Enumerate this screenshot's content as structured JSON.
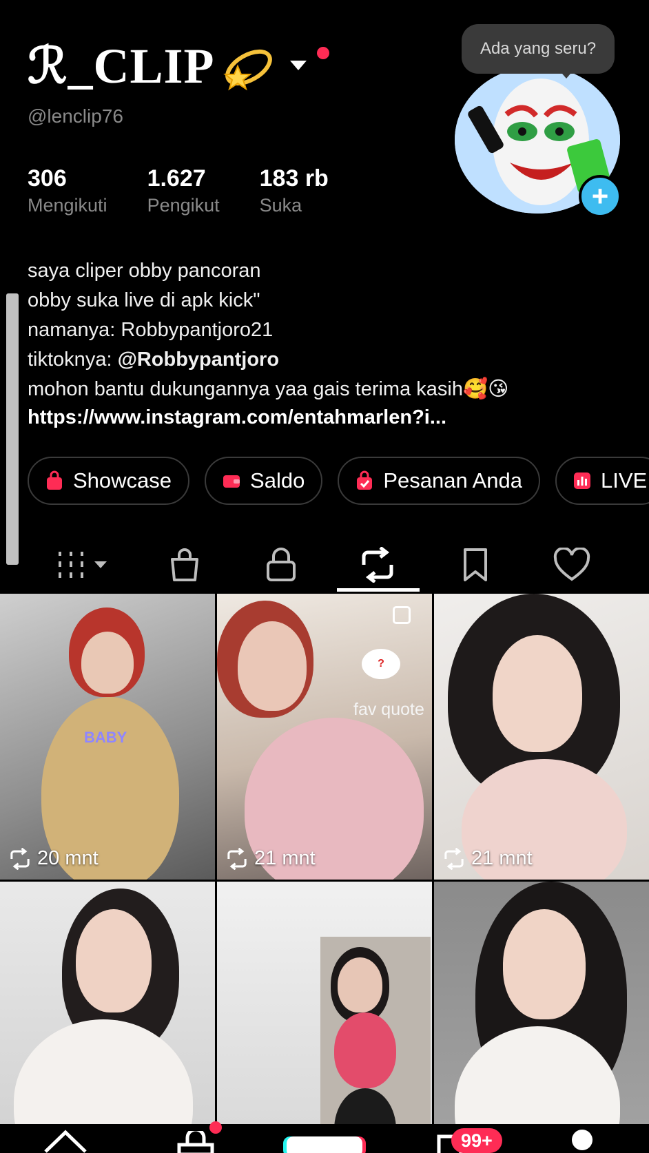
{
  "profile": {
    "display_name": "ℛ_CLIP",
    "handle": "@lenclip76",
    "tooltip": "Ada yang seru?",
    "stats": [
      {
        "value": "306",
        "label": "Mengikuti"
      },
      {
        "value": "1.627",
        "label": "Pengikut"
      },
      {
        "value": "183 rb",
        "label": "Suka"
      }
    ],
    "bio_lines": [
      "saya cliper obby pancoran",
      "obby suka live di apk kick\"",
      "namanya: Robbypantjoro21",
      "tiktoknya: ",
      "mohon bantu dukungannya yaa gais terima kasih🥰😘"
    ],
    "bio_mention": "@Robbypantjoro",
    "bio_link": "https://www.instagram.com/entahmarlen?i..."
  },
  "chips": [
    {
      "label": "Showcase",
      "icon": "shop-bag-icon",
      "color": "#fe2c55"
    },
    {
      "label": "Saldo",
      "icon": "wallet-icon",
      "color": "#fe2c55"
    },
    {
      "label": "Pesanan Anda",
      "icon": "order-bag-icon",
      "color": "#fe2c55"
    },
    {
      "label": "LIVE",
      "icon": "live-stats-icon",
      "color": "#fe2c55"
    }
  ],
  "tabs": [
    "grid-icon",
    "shop-bag-icon",
    "lock-icon",
    "repost-icon",
    "bookmark-icon",
    "heart-icon"
  ],
  "active_tab": "repost-icon",
  "videos": [
    {
      "time": "20 mnt",
      "overlay_text": "BABY"
    },
    {
      "time": "21 mnt",
      "overlay_text": "fav quote"
    },
    {
      "time": "21 mnt",
      "overlay_text": ""
    },
    {
      "time": "",
      "overlay_text": ""
    },
    {
      "time": "",
      "overlay_text": ""
    },
    {
      "time": "",
      "overlay_text": ""
    }
  ],
  "bottom_nav": {
    "inbox_badge": "99+"
  }
}
